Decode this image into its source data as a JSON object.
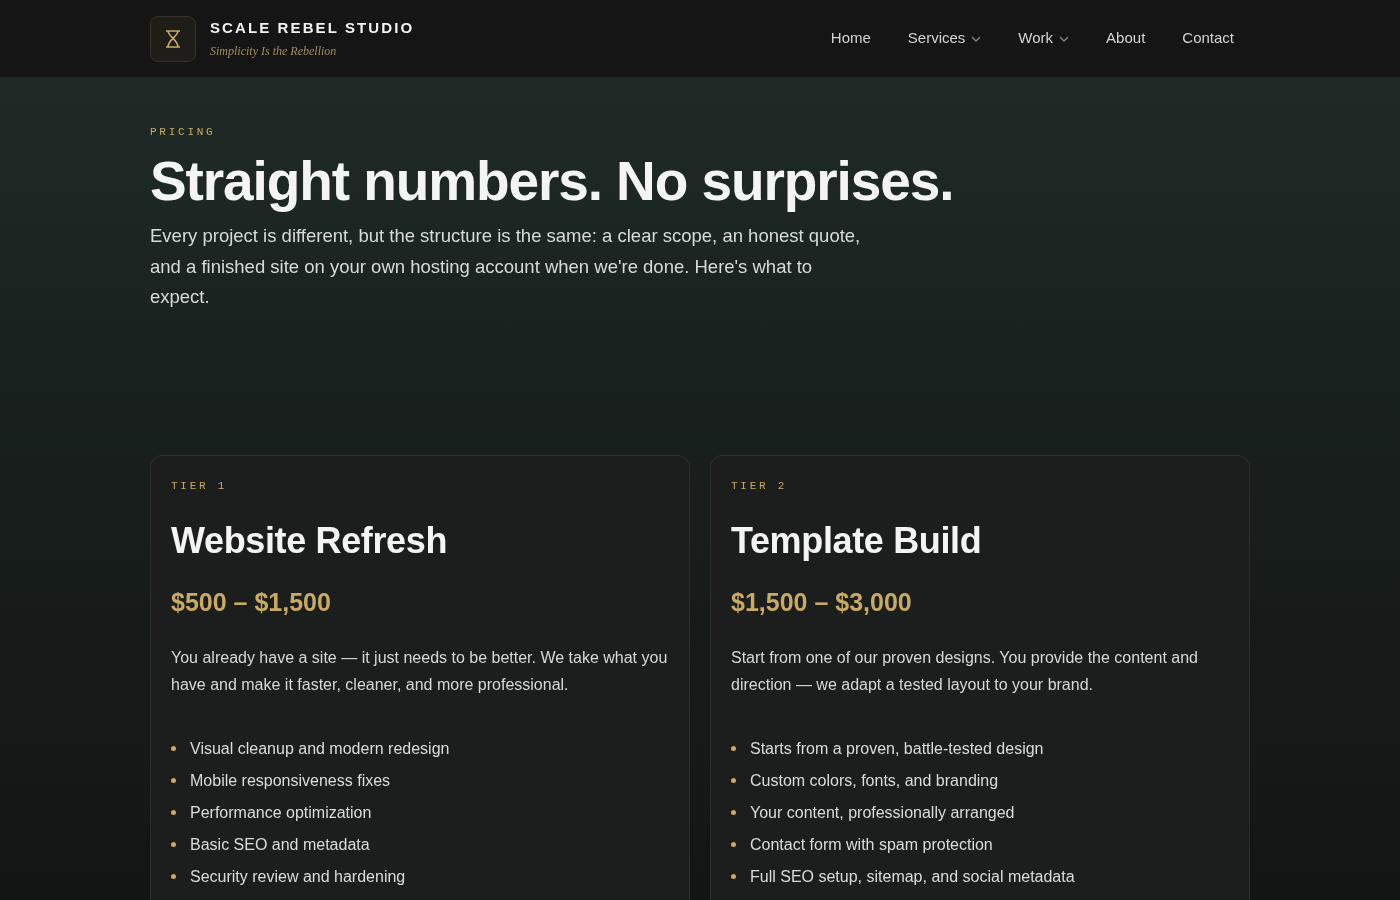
{
  "brand": {
    "name": "SCALE REBEL STUDIO",
    "tagline": "Simplicity Is the Rebellion"
  },
  "nav": [
    {
      "label": "Home",
      "has_menu": false
    },
    {
      "label": "Services",
      "has_menu": true
    },
    {
      "label": "Work",
      "has_menu": true
    },
    {
      "label": "About",
      "has_menu": false
    },
    {
      "label": "Contact",
      "has_menu": false
    }
  ],
  "hero": {
    "eyebrow": "PRICING",
    "title": "Straight numbers. No surprises.",
    "text": "Every project is different, but the structure is the same: a clear scope, an honest quote, and a finished site on your own hosting account when we're done. Here's what to expect."
  },
  "tiers": [
    {
      "tier": "TIER 1",
      "name": "Website Refresh",
      "price": "$500 – $1,500",
      "description": "You already have a site — it just needs to be better. We take what you have and make it faster, cleaner, and more professional.",
      "features": [
        "Visual cleanup and modern redesign",
        "Mobile responsiveness fixes",
        "Performance optimization",
        "Basic SEO and metadata",
        "Security review and hardening"
      ]
    },
    {
      "tier": "TIER 2",
      "name": "Template Build",
      "price": "$1,500 – $3,000",
      "description": "Start from one of our proven designs. You provide the content and direction — we adapt a tested layout to your brand.",
      "features": [
        "Starts from a proven, battle-tested design",
        "Custom colors, fonts, and branding",
        "Your content, professionally arranged",
        "Contact form with spam protection",
        "Full SEO setup, sitemap, and social metadata"
      ]
    }
  ]
}
